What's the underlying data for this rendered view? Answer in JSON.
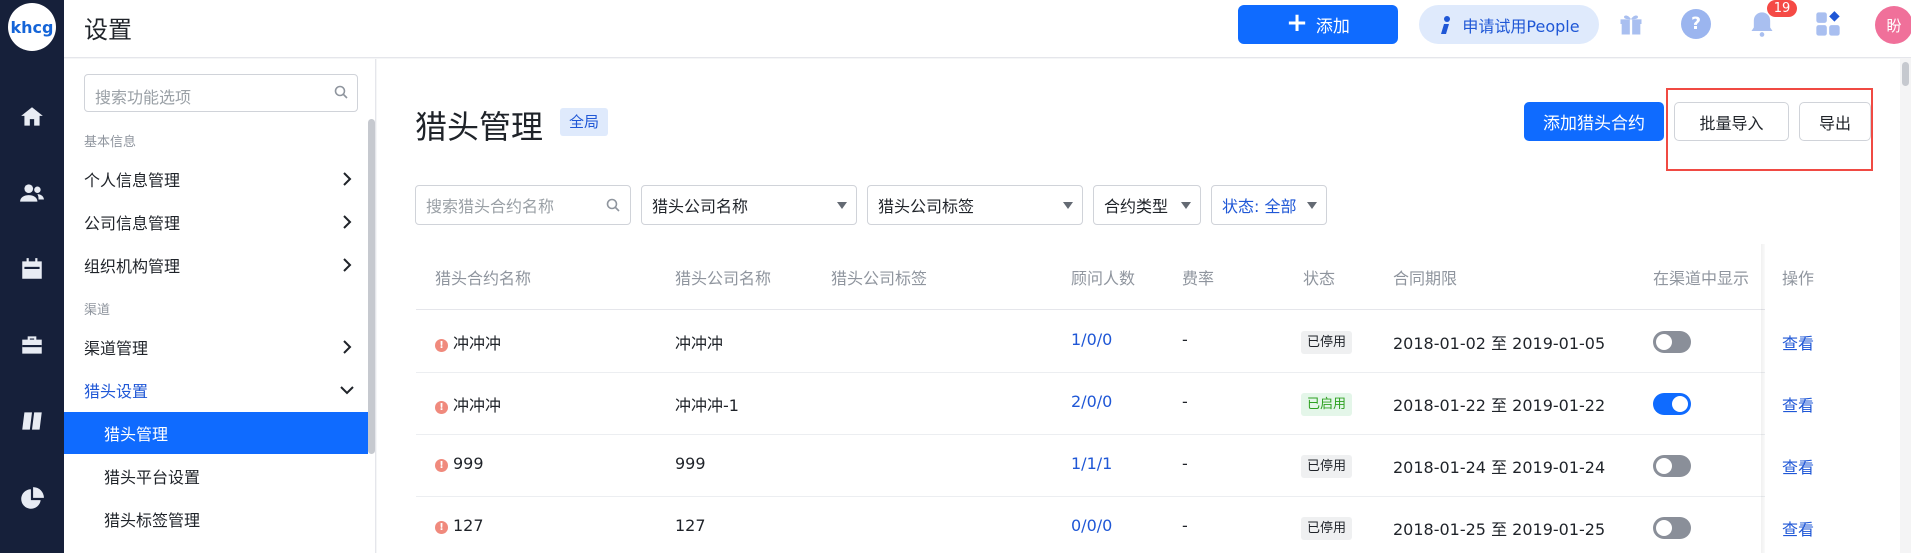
{
  "app": {
    "logo_text": "khcg",
    "title": "设置"
  },
  "topbar": {
    "add_label": "添加",
    "trial_label": "申请试用People",
    "notification_count": "19",
    "avatar_text": "盼"
  },
  "rail": {
    "icons": [
      "home-icon",
      "users-icon",
      "calendar-icon",
      "briefcase-icon",
      "book-icon",
      "pie-chart-icon"
    ]
  },
  "sidebar": {
    "search_placeholder": "搜索功能选项",
    "section_basic": "基本信息",
    "personal_info": "个人信息管理",
    "company_info": "公司信息管理",
    "org_structure": "组织机构管理",
    "section_channel": "渠道",
    "channel_mgmt": "渠道管理",
    "headhunter_settings": "猎头设置",
    "headhunter_mgmt": "猎头管理",
    "headhunter_platform": "猎头平台设置",
    "headhunter_tags": "猎头标签管理"
  },
  "page": {
    "title": "猎头管理",
    "scope_tag": "全局",
    "add_contract": "添加猎头合约",
    "batch_import": "批量导入",
    "export": "导出"
  },
  "filters": {
    "search_placeholder": "搜索猎头合约名称",
    "company_name": "猎头公司名称",
    "company_tag": "猎头公司标签",
    "contract_type": "合约类型",
    "status": "状态: 全部"
  },
  "table": {
    "columns": {
      "contract_name": "猎头合约名称",
      "company_name": "猎头公司名称",
      "company_tag": "猎头公司标签",
      "consultants": "顾问人数",
      "rate": "费率",
      "status": "状态",
      "period": "合同期限",
      "show_in_channel": "在渠道中显示",
      "actions": "操作"
    },
    "rows": [
      {
        "name": "冲冲冲",
        "company": "冲冲冲",
        "consultants": "1/0/0",
        "rate": "-",
        "status": "已停用",
        "active": false,
        "period": "2018-01-02 至 2019-01-05",
        "action": "查看"
      },
      {
        "name": "冲冲冲",
        "company": "冲冲冲-1",
        "consultants": "2/0/0",
        "rate": "-",
        "status": "已启用",
        "active": true,
        "period": "2018-01-22 至 2019-01-22",
        "action": "查看"
      },
      {
        "name": "999",
        "company": "999",
        "consultants": "1/1/1",
        "rate": "-",
        "status": "已停用",
        "active": false,
        "period": "2018-01-24 至 2019-01-24",
        "action": "查看"
      },
      {
        "name": "127",
        "company": "127",
        "consultants": "0/0/0",
        "rate": "-",
        "status": "已停用",
        "active": false,
        "period": "2018-01-25 至 2019-01-25",
        "action": "查看"
      }
    ]
  },
  "colors": {
    "primary": "#0f6bff",
    "rail": "#16203a",
    "highlight": "#f04a43",
    "active_status": "#2ea121"
  }
}
